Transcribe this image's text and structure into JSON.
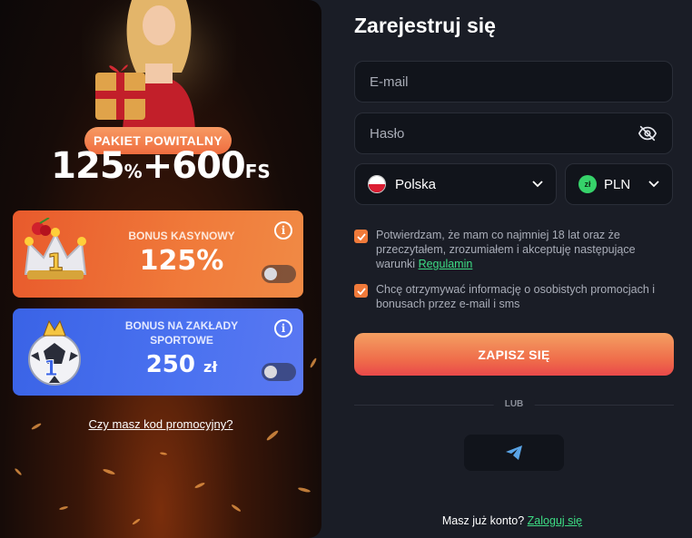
{
  "promo": {
    "badge": "PAKIET POWITALNY",
    "offer_percent": "125",
    "offer_percent_sign": "%",
    "offer_plus": "+600",
    "offer_fs": "FS",
    "casino_card": {
      "title": "BONUS KASYNOWY",
      "value": "125%",
      "enabled": false
    },
    "sport_card": {
      "title": "BONUS NA ZAKŁADY SPORTOWE",
      "value": "250",
      "value_unit": "zł",
      "enabled": false
    },
    "promo_code_link": "Czy masz kod promocyjny?"
  },
  "form": {
    "title": "Zarejestruj się",
    "email_placeholder": "E-mail",
    "password_placeholder": "Hasło",
    "country": "Polska",
    "currency_badge": "zł",
    "currency": "PLN",
    "consent_age_text": "Potwierdzam, że mam co najmniej 18 lat oraz że przeczytałem, zrozumiałem i akceptuję następujące warunki",
    "consent_age_link": "Regulamin",
    "consent_marketing_text": "Chcę otrzymywać informację o osobistych promocjach i bonusach przez e-mail i sms",
    "submit_label": "ZAPISZ SIĘ",
    "divider_label": "LUB",
    "login_prompt": "Masz już konto?",
    "login_link": "Zaloguj się"
  },
  "colors": {
    "accent_orange": "#f07a3a",
    "link_green": "#3ddc84",
    "casino_card": "#ec6a32",
    "sport_card": "#4468ea",
    "background": "#1a1d26"
  },
  "icons": [
    "info-icon",
    "eye-off-icon",
    "chevron-down-icon",
    "telegram-icon",
    "check-icon",
    "poland-flag-icon"
  ]
}
